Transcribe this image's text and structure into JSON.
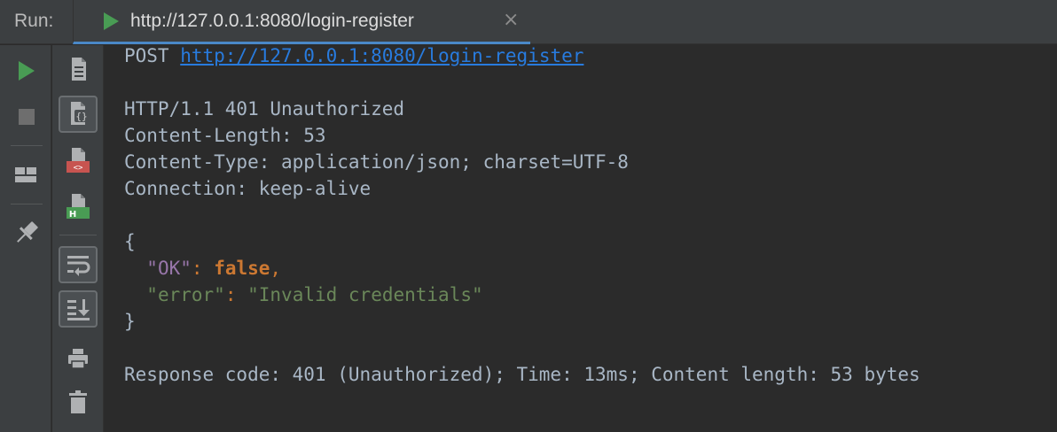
{
  "run_panel": {
    "label": "Run:",
    "tab": {
      "title": "http://127.0.0.1:8080/login-register",
      "close_glyph": "×"
    }
  },
  "left_toolbar": [
    {
      "name": "run-button",
      "icon": "play-icon",
      "color": "#499c54"
    },
    {
      "name": "stop-button",
      "icon": "stop-icon",
      "color": "#6e6e6e"
    },
    {
      "name": "layout-button",
      "icon": "layout-icon"
    },
    {
      "name": "pin-button",
      "icon": "pin-icon"
    }
  ],
  "right_toolbar": [
    {
      "name": "view-as-text-button",
      "icon": "document-icon"
    },
    {
      "name": "view-as-json-button",
      "icon": "json-document-icon",
      "selected": true
    },
    {
      "name": "view-as-xml-button",
      "icon": "xml-document-icon",
      "badge": "<>",
      "badge_color": "#c75450"
    },
    {
      "name": "view-as-html-button",
      "icon": "html-document-icon",
      "badge": "H",
      "badge_color": "#499c54"
    },
    {
      "name": "soft-wrap-button",
      "icon": "soft-wrap-icon"
    },
    {
      "name": "scroll-to-end-button",
      "icon": "scroll-to-end-icon"
    },
    {
      "name": "print-button",
      "icon": "print-icon"
    },
    {
      "name": "clear-button",
      "icon": "trash-icon"
    }
  ],
  "response": {
    "method": "POST",
    "url": "http://127.0.0.1:8080/login-register",
    "status_line": "HTTP/1.1 401 Unauthorized",
    "headers": [
      "Content-Length: 53",
      "Content-Type: application/json; charset=UTF-8",
      "Connection: keep-alive"
    ],
    "body": {
      "open": "{",
      "close": "}",
      "entries": [
        {
          "key": "\"OK\"",
          "colon": ":",
          "value": "false",
          "comma": ","
        },
        {
          "key": "\"error\"",
          "colon": ":",
          "value": "\"Invalid credentials\"",
          "comma": ""
        }
      ]
    },
    "summary": "Response code: 401 (Unauthorized); Time: 13ms; Content length: 53 bytes"
  },
  "colors": {
    "background": "#2b2b2b",
    "panel": "#3c3f41",
    "text": "#a9b7c6",
    "link": "#287bde",
    "json_key": "#9876aa",
    "json_string": "#6a8759",
    "json_keyword": "#cc7832"
  }
}
